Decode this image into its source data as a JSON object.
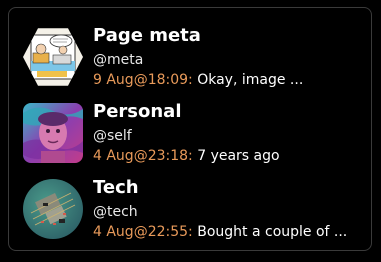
{
  "chats": [
    {
      "title": "Page meta",
      "handle": "@meta",
      "timestamp": "9 Aug@18:09:",
      "preview": "Okay, image ...",
      "avatar_icon": "comic-strip-avatar"
    },
    {
      "title": "Personal",
      "handle": "@self",
      "timestamp": "4 Aug@23:18:",
      "preview": "7 years ago",
      "avatar_icon": "portrait-avatar"
    },
    {
      "title": "Tech",
      "handle": "@tech",
      "timestamp": "4 Aug@22:55:",
      "preview": "Bought a couple of ...",
      "avatar_icon": "circuit-board-avatar"
    }
  ],
  "colors": {
    "background": "#000000",
    "border": "#3a3a3a",
    "timestamp": "#e89a5a",
    "text": "#ffffff"
  }
}
